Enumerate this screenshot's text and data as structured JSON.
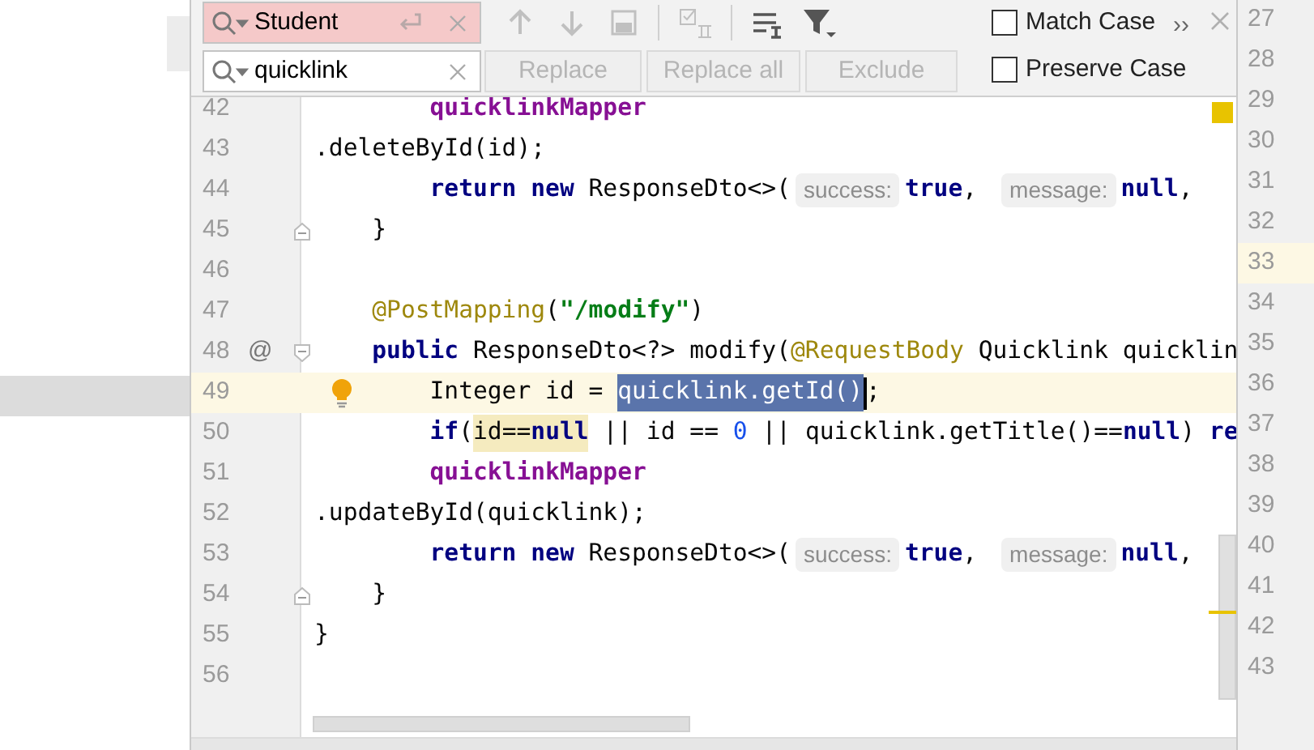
{
  "search": {
    "find": {
      "value": "Student",
      "no_match": true
    },
    "replace": {
      "value": "quicklink"
    },
    "buttons": [
      {
        "label": "Replace",
        "disabled": true
      },
      {
        "label": "Replace all",
        "disabled": true
      },
      {
        "label": "Exclude",
        "disabled": true
      }
    ],
    "options": [
      {
        "label": "Match Case",
        "checked": false
      },
      {
        "label": "Preserve Case",
        "checked": false
      }
    ],
    "more": "››"
  },
  "editor": {
    "lines": [
      {
        "number": "42",
        "tokens": [
          {
            "t": "        quicklinkMapper",
            "kind": "field"
          }
        ]
      },
      {
        "number": "43",
        "tokens": [
          {
            "t": ".deleteById(id);",
            "kind": "plain"
          }
        ]
      },
      {
        "number": "44",
        "tokens": [
          {
            "t": "        return new",
            "kind": "keyword"
          },
          {
            "t": " ResponseDto<>(",
            "kind": "plain"
          },
          {
            "t": "success:",
            "kind": "hint"
          },
          {
            "t": "true",
            "kind": "keyword"
          },
          {
            "t": ",",
            "kind": "plain"
          },
          {
            "t": "message:",
            "kind": "hint"
          },
          {
            "t": "null",
            "kind": "keyword"
          },
          {
            "t": ",",
            "kind": "plain"
          }
        ]
      },
      {
        "number": "45",
        "fold_end": true,
        "tokens": [
          {
            "t": "    }",
            "kind": "plain"
          }
        ]
      },
      {
        "number": "46"
      },
      {
        "number": "47",
        "tokens": [
          {
            "t": "    @PostMapping",
            "kind": "annotation"
          },
          {
            "t": "(",
            "kind": "plain"
          },
          {
            "t": "\"/modify\"",
            "kind": "string"
          },
          {
            "t": ")",
            "kind": "plain"
          }
        ]
      },
      {
        "number": "48",
        "gutter_mark": "@",
        "fold_start": true,
        "tokens": [
          {
            "t": "    public",
            "kind": "keyword"
          },
          {
            "t": " ResponseDto<?> modify(",
            "kind": "plain"
          },
          {
            "t": "@RequestBody",
            "kind": "annotation"
          },
          {
            "t": " Quicklink quicklin",
            "kind": "plain"
          }
        ]
      },
      {
        "number": "49",
        "current": true,
        "bulb": true,
        "tokens": [
          {
            "t": "        Integer id = ",
            "kind": "plain"
          },
          {
            "t": "quicklink.getId()",
            "kind": "selected"
          },
          {
            "t": ";",
            "kind": "plain"
          }
        ]
      },
      {
        "number": "50",
        "tokens": [
          {
            "t": "        if",
            "kind": "keyword"
          },
          {
            "t": "(",
            "kind": "plain"
          },
          {
            "t": "id==",
            "kind": "usage"
          },
          {
            "t": "null",
            "kind": "keyword_usage"
          },
          {
            "t": " || id == ",
            "kind": "plain"
          },
          {
            "t": "0",
            "kind": "number"
          },
          {
            "t": " || quicklink.getTitle()==",
            "kind": "plain"
          },
          {
            "t": "null",
            "kind": "keyword"
          },
          {
            "t": ") ",
            "kind": "plain"
          },
          {
            "t": "re",
            "kind": "keyword"
          }
        ]
      },
      {
        "number": "51",
        "tokens": [
          {
            "t": "        quicklinkMapper",
            "kind": "field"
          }
        ]
      },
      {
        "number": "52",
        "tokens": [
          {
            "t": ".updateById(quicklink);",
            "kind": "plain"
          }
        ]
      },
      {
        "number": "53",
        "tokens": [
          {
            "t": "        return new",
            "kind": "keyword"
          },
          {
            "t": " ResponseDto<>(",
            "kind": "plain"
          },
          {
            "t": "success:",
            "kind": "hint"
          },
          {
            "t": "true",
            "kind": "keyword"
          },
          {
            "t": ",",
            "kind": "plain"
          },
          {
            "t": "message:",
            "kind": "hint"
          },
          {
            "t": "null",
            "kind": "keyword"
          },
          {
            "t": ",",
            "kind": "plain"
          }
        ]
      },
      {
        "number": "54",
        "fold_end": true,
        "tokens": [
          {
            "t": "    }",
            "kind": "plain"
          }
        ]
      },
      {
        "number": "55",
        "tokens": [
          {
            "t": "}",
            "kind": "plain"
          }
        ]
      },
      {
        "number": "56"
      }
    ]
  },
  "side_lines": [
    {
      "number": "27"
    },
    {
      "number": "28"
    },
    {
      "number": "29"
    },
    {
      "number": "30"
    },
    {
      "number": "31"
    },
    {
      "number": "32"
    },
    {
      "number": "33",
      "current": true
    },
    {
      "number": "34"
    },
    {
      "number": "35"
    },
    {
      "number": "36"
    },
    {
      "number": "37"
    },
    {
      "number": "38"
    },
    {
      "number": "39"
    },
    {
      "number": "40"
    },
    {
      "number": "41"
    },
    {
      "number": "42"
    },
    {
      "number": "43"
    }
  ]
}
